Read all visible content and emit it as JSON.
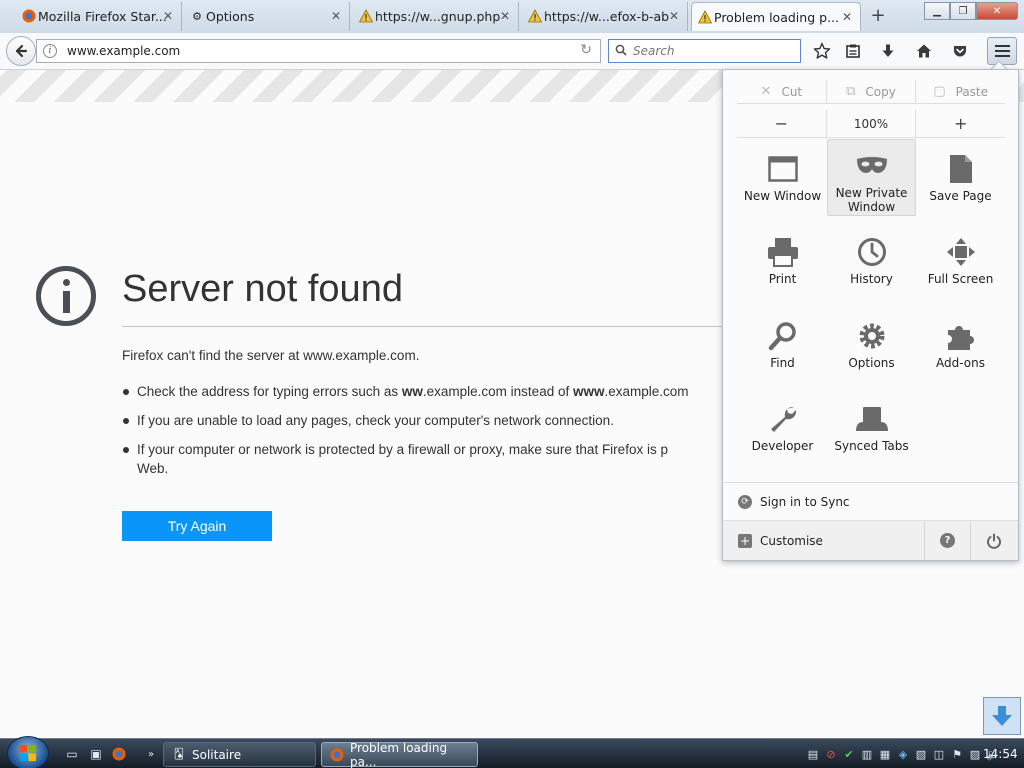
{
  "tabs": [
    {
      "label": "Mozilla Firefox Star...",
      "icon": "firefox-icon"
    },
    {
      "label": "Options",
      "icon": "gear-icon"
    },
    {
      "label": "https://w...gnup.php",
      "icon": "warning-icon"
    },
    {
      "label": "https://w...efox-b-ab",
      "icon": "warning-icon"
    },
    {
      "label": "Problem loading p...",
      "icon": "warning-icon"
    }
  ],
  "navbar": {
    "url": "www.example.com",
    "search_placeholder": "Search"
  },
  "error": {
    "title": "Server not found",
    "description": "Firefox can't find the server at www.example.com.",
    "bullet1_pre": "Check the address for typing errors such as ",
    "bullet1_b1": "ww",
    "bullet1_mid1": ".example.com instead of ",
    "bullet1_b2": "www",
    "bullet1_end": ".example.com",
    "bullet2": "If you are unable to load any pages, check your computer's network connection.",
    "bullet3": "If your computer or network is protected by a firewall or proxy, make sure that Firefox is permitted to access the Web.",
    "bullet3_line1": "If your computer or network is protected by a firewall or proxy, make sure that Firefox is p",
    "bullet3_line2": "Web.",
    "try_again": "Try Again"
  },
  "menu": {
    "cut": "Cut",
    "copy": "Copy",
    "paste": "Paste",
    "zoom_out": "−",
    "zoom_level": "100%",
    "zoom_in": "+",
    "items": [
      {
        "label": "New Window",
        "icon": "window-icon"
      },
      {
        "label": "New Private Window",
        "icon": "mask-icon"
      },
      {
        "label": "Save Page",
        "icon": "save-page-icon"
      },
      {
        "label": "Print",
        "icon": "printer-icon"
      },
      {
        "label": "History",
        "icon": "clock-icon"
      },
      {
        "label": "Full Screen",
        "icon": "fullscreen-icon"
      },
      {
        "label": "Find",
        "icon": "magnifier-icon"
      },
      {
        "label": "Options",
        "icon": "gear-icon"
      },
      {
        "label": "Add-ons",
        "icon": "puzzle-icon"
      },
      {
        "label": "Developer",
        "icon": "wrench-icon"
      },
      {
        "label": "Synced Tabs",
        "icon": "synced-tabs-icon"
      }
    ],
    "sign_in": "Sign in to Sync",
    "customise": "Customise"
  },
  "taskbar": {
    "tasks": [
      {
        "label": "Solitaire"
      },
      {
        "label": "Problem loading pa..."
      }
    ],
    "clock": "14:54"
  },
  "colors": {
    "accent": "#0996f8",
    "menu_icon": "#6a6a6a"
  }
}
